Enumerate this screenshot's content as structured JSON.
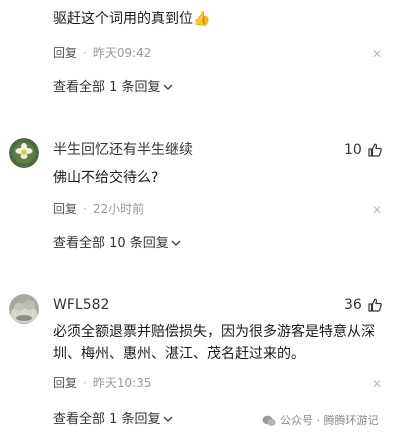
{
  "comments": [
    {
      "text": "驱赶这个词用的真到位",
      "text_emoji": "👍",
      "reply_label": "回复",
      "time": "昨天09:42",
      "view_all": "查看全部 1 条回复"
    },
    {
      "username": "半生回忆还有半生继续",
      "likes": "10",
      "text": "佛山不给交待么?",
      "reply_label": "回复",
      "time": "22小时前",
      "view_all": "查看全部 10 条回复"
    },
    {
      "username": "WFL582",
      "likes": "36",
      "text_line1": "必须全额退票并赔偿损失，因为很多游客是特意从深",
      "text_line2": "圳、梅州、惠州、湛江、茂名赶过来的。",
      "reply_label": "回复",
      "time": "昨天10:35",
      "view_all": "查看全部 1 条回复"
    }
  ],
  "watermark": "公众号 · 腾腾环游记",
  "icons": {
    "close": "close-icon",
    "like": "thumbs-up-icon",
    "chevron": "chevron-down-icon"
  }
}
